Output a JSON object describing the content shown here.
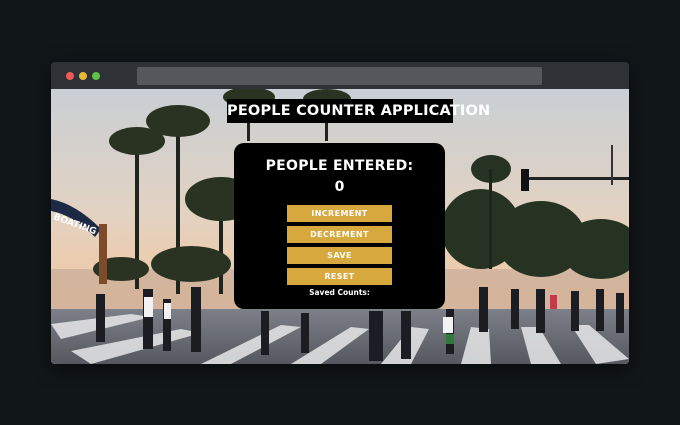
{
  "app": {
    "title": "PEOPLE COUNTER APPLICATION"
  },
  "counter": {
    "heading": "PEOPLE ENTERED:",
    "value": "0"
  },
  "buttons": {
    "increment": "INCREMENT",
    "decrement": "DECREMENT",
    "save": "SAVE",
    "reset": "RESET"
  },
  "saved": {
    "label": "Saved Counts:"
  },
  "background": {
    "sign_text": "BOATING"
  },
  "colors": {
    "accent": "#d7a83d",
    "panel": "#000000",
    "window_chrome": "#2e3236"
  }
}
